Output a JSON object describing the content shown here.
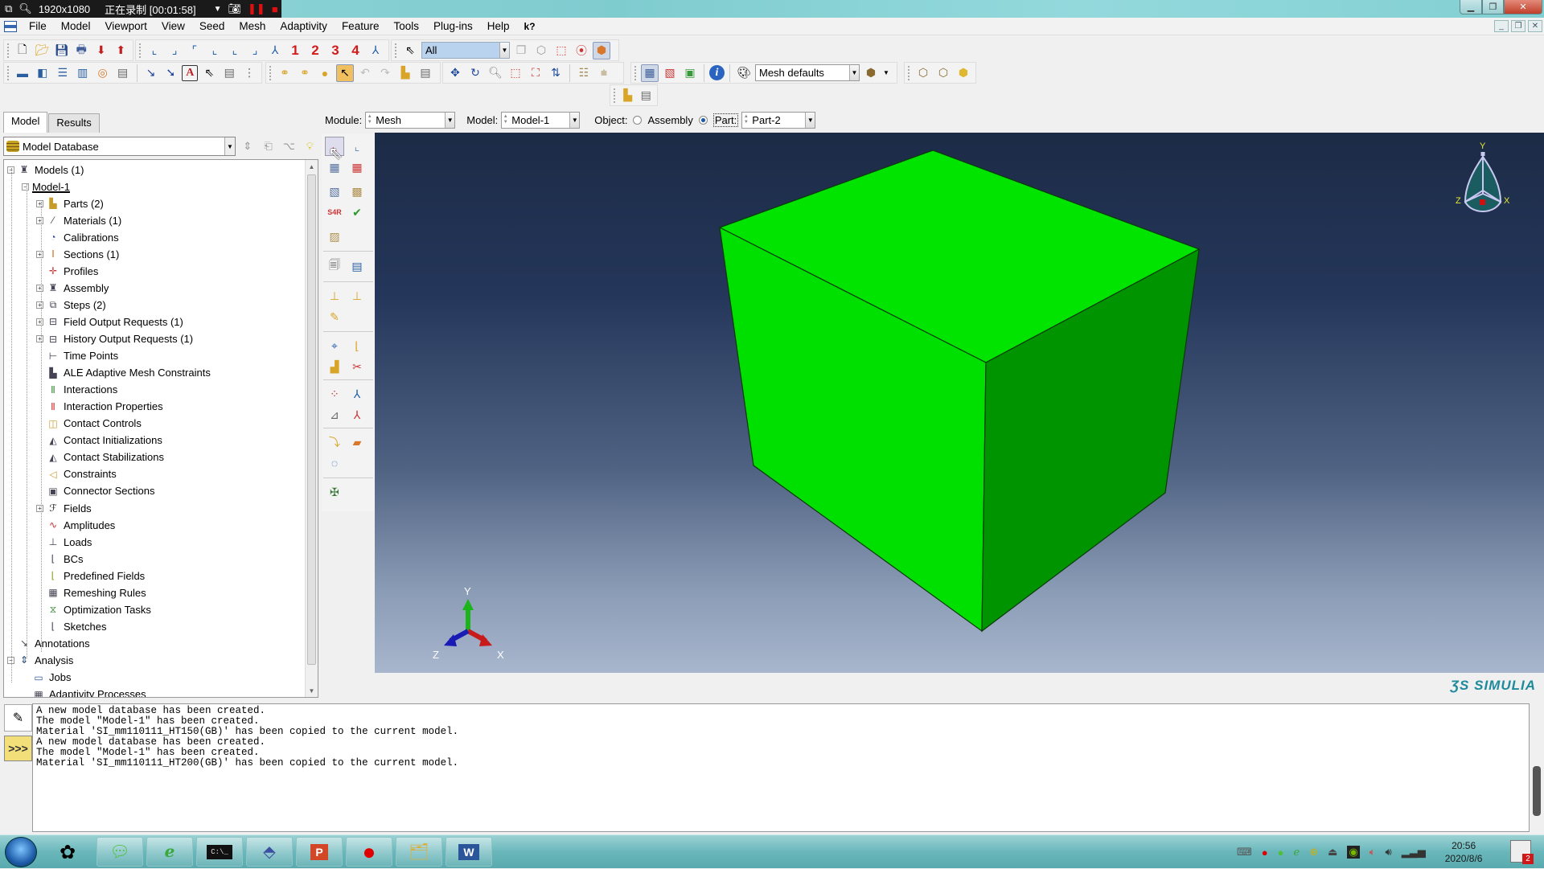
{
  "recorder": {
    "resolution": "1920x1080",
    "status": "正在录制 [00:01:58]"
  },
  "menu": {
    "items": [
      "File",
      "Model",
      "Viewport",
      "View",
      "Seed",
      "Mesh",
      "Adaptivity",
      "Feature",
      "Tools",
      "Plug-ins",
      "Help"
    ],
    "help_cursor": "k?"
  },
  "toolbar": {
    "selection_filter": "All",
    "view_numbers": [
      "1",
      "2",
      "3",
      "4"
    ],
    "render_style": "Mesh defaults"
  },
  "left_panel": {
    "tabs": [
      {
        "label": "Model",
        "active": true
      },
      {
        "label": "Results",
        "active": false
      }
    ],
    "database_combo": "Model Database",
    "tree": [
      {
        "label": "Models (1)",
        "level": 0,
        "expander": "minus",
        "icon": "models-icon"
      },
      {
        "label": "Model-1",
        "level": 1,
        "expander": "minus",
        "icon": "",
        "underline": true
      },
      {
        "label": "Parts (2)",
        "level": 2,
        "expander": "plus",
        "icon": "parts-icon"
      },
      {
        "label": "Materials (1)",
        "level": 2,
        "expander": "plus",
        "icon": "materials-icon"
      },
      {
        "label": "Calibrations",
        "level": 2,
        "expander": "",
        "icon": "calibrations-icon"
      },
      {
        "label": "Sections (1)",
        "level": 2,
        "expander": "plus",
        "icon": "sections-icon"
      },
      {
        "label": "Profiles",
        "level": 2,
        "expander": "",
        "icon": "profiles-icon"
      },
      {
        "label": "Assembly",
        "level": 2,
        "expander": "plus",
        "icon": "assembly-icon"
      },
      {
        "label": "Steps (2)",
        "level": 2,
        "expander": "plus",
        "icon": "steps-icon"
      },
      {
        "label": "Field Output Requests (1)",
        "level": 2,
        "expander": "plus",
        "icon": "field-output-icon"
      },
      {
        "label": "History Output Requests (1)",
        "level": 2,
        "expander": "plus",
        "icon": "history-output-icon"
      },
      {
        "label": "Time Points",
        "level": 2,
        "expander": "",
        "icon": "time-points-icon"
      },
      {
        "label": "ALE Adaptive Mesh Constraints",
        "level": 2,
        "expander": "",
        "icon": "ale-constraints-icon"
      },
      {
        "label": "Interactions",
        "level": 2,
        "expander": "",
        "icon": "interactions-icon"
      },
      {
        "label": "Interaction Properties",
        "level": 2,
        "expander": "",
        "icon": "interaction-properties-icon"
      },
      {
        "label": "Contact Controls",
        "level": 2,
        "expander": "",
        "icon": "contact-controls-icon"
      },
      {
        "label": "Contact Initializations",
        "level": 2,
        "expander": "",
        "icon": "contact-initializations-icon"
      },
      {
        "label": "Contact Stabilizations",
        "level": 2,
        "expander": "",
        "icon": "contact-stabilizations-icon"
      },
      {
        "label": "Constraints",
        "level": 2,
        "expander": "",
        "icon": "constraints-icon"
      },
      {
        "label": "Connector Sections",
        "level": 2,
        "expander": "",
        "icon": "connector-sections-icon"
      },
      {
        "label": "Fields",
        "level": 2,
        "expander": "plus",
        "icon": "fields-icon"
      },
      {
        "label": "Amplitudes",
        "level": 2,
        "expander": "",
        "icon": "amplitudes-icon"
      },
      {
        "label": "Loads",
        "level": 2,
        "expander": "",
        "icon": "loads-icon"
      },
      {
        "label": "BCs",
        "level": 2,
        "expander": "",
        "icon": "bcs-icon"
      },
      {
        "label": "Predefined Fields",
        "level": 2,
        "expander": "",
        "icon": "predefined-fields-icon"
      },
      {
        "label": "Remeshing Rules",
        "level": 2,
        "expander": "",
        "icon": "remeshing-rules-icon"
      },
      {
        "label": "Optimization Tasks",
        "level": 2,
        "expander": "",
        "icon": "optimization-tasks-icon"
      },
      {
        "label": "Sketches",
        "level": 2,
        "expander": "",
        "icon": "sketches-icon"
      },
      {
        "label": "Annotations",
        "level": 0,
        "expander": "",
        "icon": "annotations-icon"
      },
      {
        "label": "Analysis",
        "level": 0,
        "expander": "minus",
        "icon": "analysis-icon"
      },
      {
        "label": "Jobs",
        "level": 1,
        "expander": "",
        "icon": "jobs-icon"
      },
      {
        "label": "Adaptivity Processes",
        "level": 1,
        "expander": "",
        "icon": "adaptivity-processes-icon"
      }
    ]
  },
  "context_bar": {
    "module_label": "Module:",
    "module_value": "Mesh",
    "model_label": "Model:",
    "model_value": "Model-1",
    "object_label": "Object:",
    "assembly_label": "Assembly",
    "part_label": "Part:",
    "part_value": "Part-2",
    "object_selected": "Part"
  },
  "viewport": {
    "part_color": "#00e400",
    "part_side_color": "#009400",
    "triad_labels": {
      "x": "X",
      "y": "Y",
      "z": "Z"
    },
    "view_cube_labels": {
      "x": "X",
      "y": "Y",
      "z": "Z"
    },
    "brand": "SIMULIA"
  },
  "messages": [
    "A new model database has been created.",
    "The model \"Model-1\" has been created.",
    "Material 'SI_mm110111_HT150(GB)' has been copied to the current model.",
    "A new model database has been created.",
    "The model \"Model-1\" has been created.",
    "Material 'SI_mm110111_HT200(GB)' has been copied to the current model."
  ],
  "message_buttons": {
    "log_icon": "message-log-icon",
    "python_prompt": ">>>"
  },
  "taskbar": {
    "apps": [
      "start-button",
      "app-launcher",
      "wechat",
      "browser",
      "command-prompt",
      "abaqus",
      "powerpoint",
      "recorder",
      "file-explorer",
      "word"
    ],
    "time": "20:56",
    "date": "2020/8/6",
    "notification_count": "2"
  }
}
